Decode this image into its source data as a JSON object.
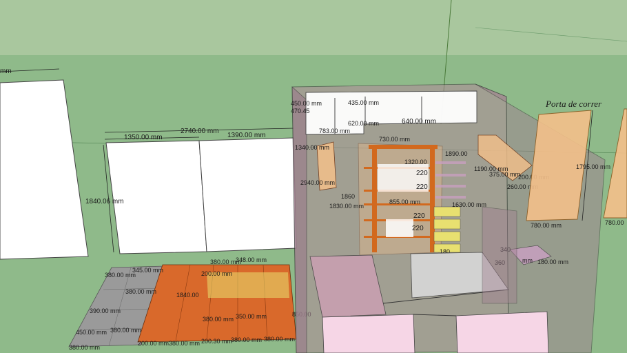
{
  "colors": {
    "sky": "#a9c79e",
    "ground": "#8fba8a",
    "wall_white": "#ffffff",
    "translucent_wall": "#b08a9a",
    "shelf_orange": "#d2691e",
    "door_peach": "#f4c08a",
    "bed_pink": "#f6d6e6",
    "rug_orange": "#d9692b",
    "tile_grey": "#9a9a9a",
    "drawer_yellow": "#e8e070"
  },
  "labels": {
    "porta_de_correr": "Porta de correr",
    "mm_left": "mm",
    "w2740": "2740.00 mm",
    "w1350": "1350.00 mm",
    "w1390": "1390.00 mm",
    "h1840": "1840.06 mm",
    "d450_top": "450.00 mm",
    "d470": "470.45",
    "d435": "435.00 mm",
    "d620": "620.00 mm",
    "d640": "640.00 mm",
    "d783": "783.00 mm",
    "d730": "730.00 mm",
    "d1340": "1340.00 mm",
    "d2940": "2940.00 mm",
    "d1320": "1320.00",
    "d220a": "220",
    "d220b": "220",
    "d220c": "220",
    "d220d": "220",
    "d1860": "1860",
    "d855": "855.00 mm",
    "d1830": "1830.00 mm",
    "d1630": "1630.00 mm",
    "d1890": "1890.00",
    "d1190": "1190.00 mm",
    "d375": "375.00 mm",
    "d200": "200.00 mm",
    "d260": "260.00 mm",
    "d1795": "1795.00 mm",
    "d780a": "780.00 mm",
    "d780b": "780.00",
    "d180": "180.00 mm",
    "d360": "360",
    "d340": "340",
    "d180b": "180",
    "mm_box": "mm",
    "d380_top": "380.00 mm",
    "d348": "348.00 mm",
    "d345": "345.00 mm",
    "d200_rug": "200.00 mm",
    "d380_left": "380.00 mm",
    "d380_mid": "380.00 mm",
    "d1840_rug": "1840.00",
    "d380_rug": "380.00 mm",
    "d350": "350.00 mm",
    "d850": "850.00",
    "d390": "390.00 mm",
    "d450_bot": "450.00 mm",
    "d380_bot1": "380.00 mm",
    "d380_bot2": "380.00 mm",
    "d200_bot1": "200.00 mm",
    "d200_bot2": "200.30 mm",
    "d380_bot3": "380.00 mm",
    "d380_bot4": "380.00 mm",
    "d380_bot5": "380.00 mm"
  }
}
